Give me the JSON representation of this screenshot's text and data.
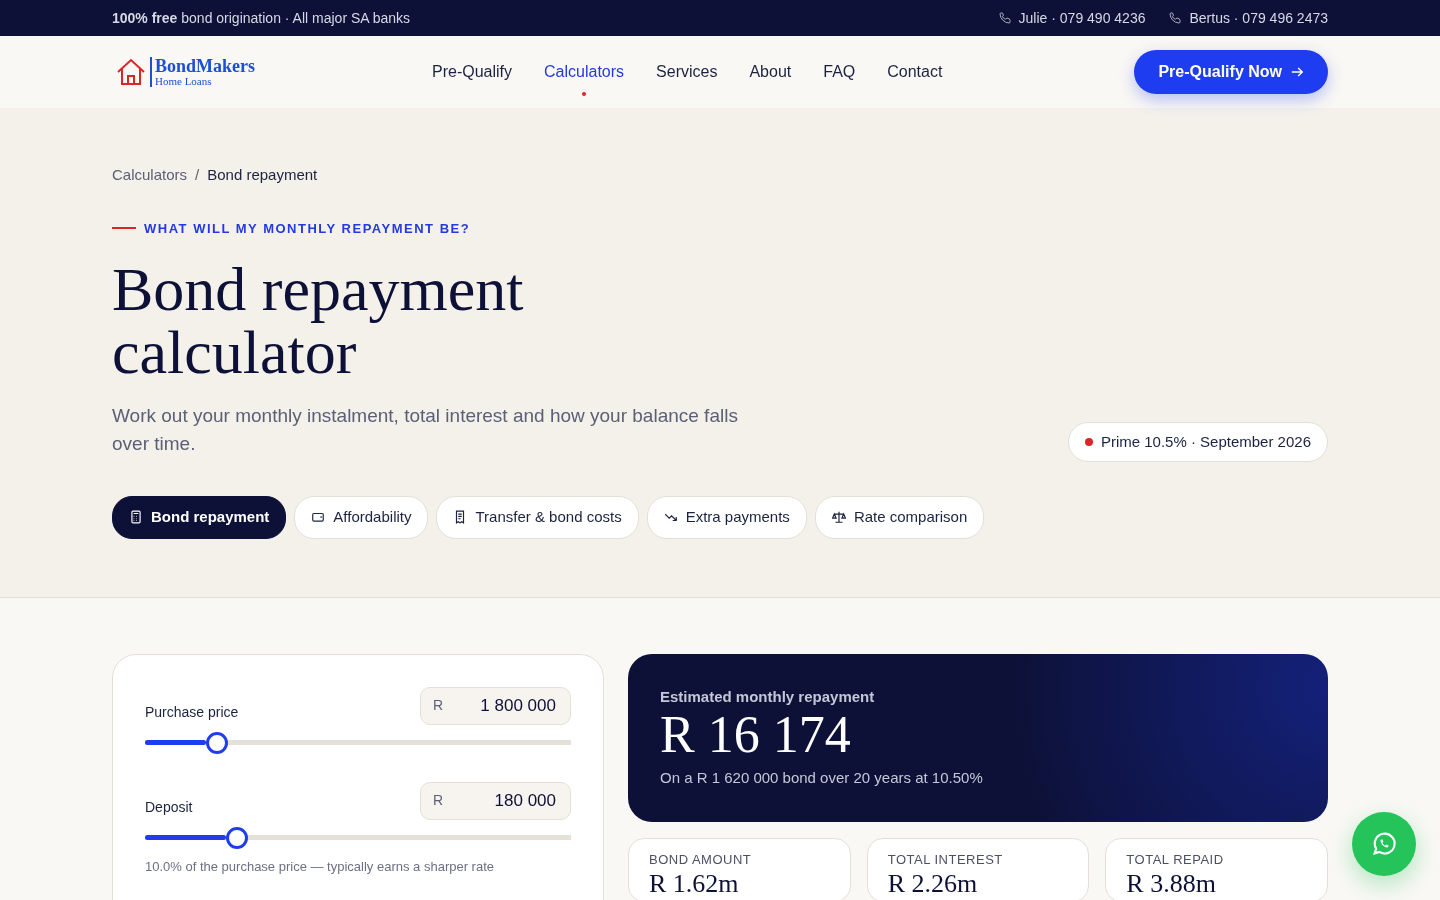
{
  "topbar": {
    "promo": "**100% free** bond origination · All major SA banks",
    "contacts": [
      "Julie · 079 490 4236",
      "Bertus · 079 496 2473"
    ]
  },
  "nav": {
    "logo": {
      "name": "BondMakers",
      "tagline": "Home Loans"
    },
    "links": [
      {
        "label": "Pre-Qualify",
        "selected": false
      },
      {
        "label": "Calculators",
        "selected": true
      },
      {
        "label": "Services",
        "selected": false
      },
      {
        "label": "About",
        "selected": false
      },
      {
        "label": "FAQ",
        "selected": false
      },
      {
        "label": "Contact",
        "selected": false
      }
    ],
    "cta": "Pre-Qualify Now"
  },
  "breadcrumb": [
    "Calculators",
    "Bond repayment"
  ],
  "breadcrumb_separator": "/",
  "eyebrow": "WHAT WILL MY MONTHLY REPAYMENT BE?",
  "title": "Bond repayment calculator",
  "subtitle": "Work out your monthly instalment, total interest and how your balance falls over time.",
  "rate_badge": {
    "text": "Prime 10.5% · September 2026",
    "color": "#dc2626"
  },
  "calc_tabs": [
    {
      "label": "Bond repayment",
      "kind": "calculator",
      "selected": true
    },
    {
      "label": "Affordability",
      "kind": "wallet",
      "selected": false
    },
    {
      "label": "Transfer & bond costs",
      "kind": "receipt",
      "selected": false
    },
    {
      "label": "Extra payments",
      "kind": "trend",
      "selected": false
    },
    {
      "label": "Rate comparison",
      "kind": "scale",
      "selected": false
    }
  ],
  "inputs": [
    {
      "label": "Purchase price",
      "prefix": "R",
      "value": "1 800 000",
      "level": 0.17
    },
    {
      "label": "Deposit",
      "prefix": "R",
      "value": "180 000",
      "level": 0.215,
      "hint": "10.0% of the purchase price — typically earns a sharper rate"
    }
  ],
  "result": {
    "label": "Estimated monthly repayment",
    "amount": "R 16 174",
    "detail": "On a R 1 620 000 bond over 20 years at 10.50%"
  },
  "stats": [
    {
      "label": "BOND AMOUNT",
      "value": "R 1.62m"
    },
    {
      "label": "TOTAL INTEREST",
      "value": "R 2.26m"
    },
    {
      "label": "TOTAL REPAID",
      "value": "R 3.88m"
    }
  ]
}
